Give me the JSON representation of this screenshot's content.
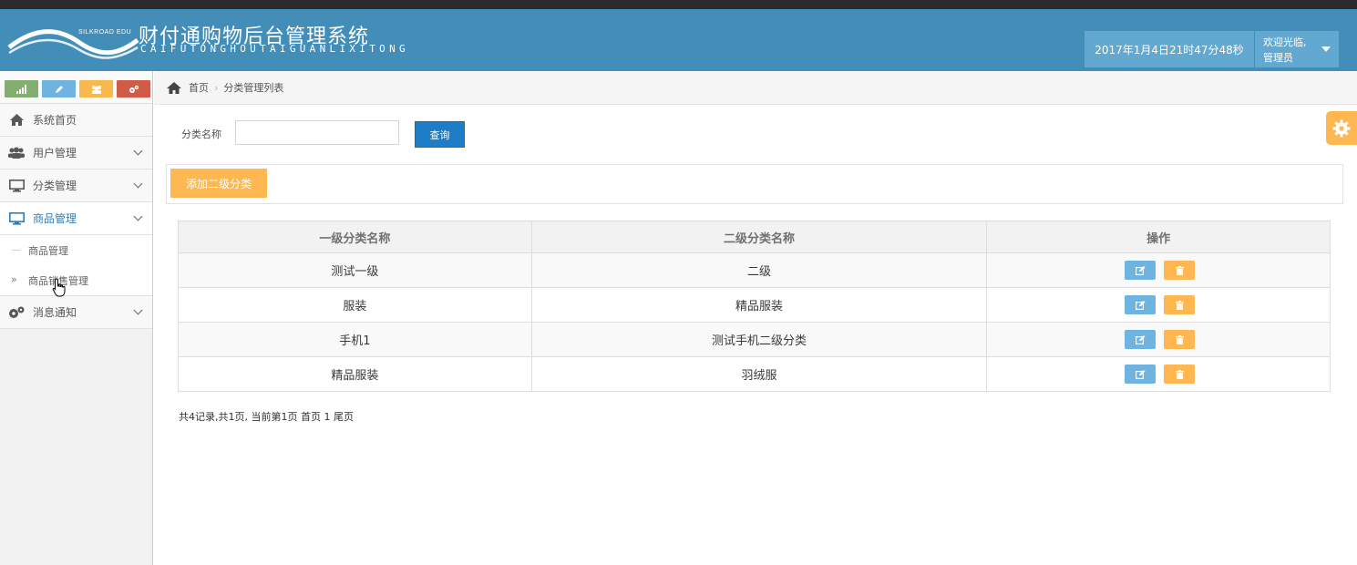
{
  "header": {
    "logo_small": "SILKROAD EDU",
    "title_cn": "财付通购物后台管理系统",
    "title_en": "CAIFUTONGHOUTAIGUANLIXITONG",
    "datetime": "2017年1月4日21时47分48秒",
    "welcome": "欢迎光临,",
    "role": "管理员"
  },
  "colors": {
    "header_bg": "#438eb9",
    "primary_button": "#1d7dc7",
    "warning": "#ffb752",
    "info": "#6fb3e0",
    "success": "#82af6f",
    "danger": "#d15b47"
  },
  "shortcut_icons": [
    "signal-icon",
    "pencil-icon",
    "group-icon",
    "cogs-icon"
  ],
  "sidebar": {
    "items": [
      {
        "label": "系统首页",
        "icon": "home-icon"
      },
      {
        "label": "用户管理",
        "icon": "users-icon"
      },
      {
        "label": "分类管理",
        "icon": "desktop-icon"
      },
      {
        "label": "商品管理",
        "icon": "desktop-icon"
      },
      {
        "label": "消息通知",
        "icon": "cogs-icon"
      }
    ],
    "sub_items": [
      {
        "label": "商品管理"
      },
      {
        "label": "商品销售管理"
      }
    ]
  },
  "breadcrumb": {
    "home": "首页",
    "current": "分类管理列表"
  },
  "search": {
    "label": "分类名称",
    "value": "",
    "button": "查询"
  },
  "add_button": "添加二级分类",
  "table": {
    "headers": [
      "一级分类名称",
      "二级分类名称",
      "操作"
    ],
    "rows": [
      {
        "level1": "测试一级",
        "level2": "二级"
      },
      {
        "level1": "服装",
        "level2": "精品服装"
      },
      {
        "level1": "手机1",
        "level2": "测试手机二级分类"
      },
      {
        "level1": "精品服装",
        "level2": "羽绒服"
      }
    ]
  },
  "pager": "共4记录,共1页, 当前第1页 首页 1 尾页"
}
